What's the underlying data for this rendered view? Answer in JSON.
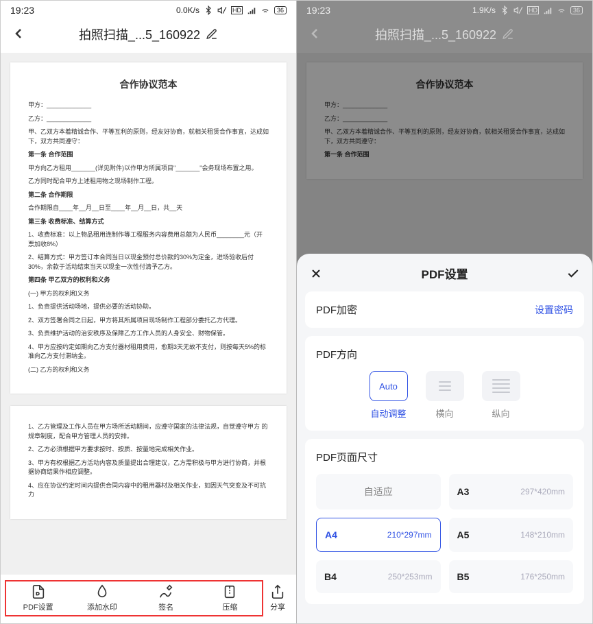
{
  "status": {
    "time": "19:23",
    "net_left": "0.0K/s",
    "net_right": "1.9K/s",
    "battery": "36"
  },
  "header": {
    "title": "拍照扫描_...5_160922"
  },
  "doc": {
    "title": "合作协议范本",
    "p1": "甲方：_____________",
    "p2": "乙方：_____________",
    "p3": "甲、乙双方本着精诚合作、平等互利的原则，经友好协商，就相关租赁合作事宜，达成如下，双方共同遵守：",
    "s1": "第一条  合作范围",
    "p4": "甲方向乙方租用_______(详见附件)以作甲方所属项目\"_______\"会务现场布置之用。",
    "p5": "乙方同时配合甲方上述租用物之现场制作工程。",
    "s2": "第二条  合作期限",
    "p6": "合作期限自____年__月__日至____年__月__日，共__天",
    "s3": "第三条  收费标准、结算方式",
    "p7": "1、收费标准：以上物品租用连制作等工程服务内容费用总额为人民币________元（开票加收8%）",
    "p8": "2、结算方式：甲方签订本合同当日以现金预付总价款的30%为定金，进场验收后付30%，余款于活动结束当天以现金一次性付清予乙方。",
    "s4": "第四条  甲乙双方的权利和义务",
    "p9": "(一) 甲方的权利和义务",
    "p10": "1、负责提供活动场地，提供必要的活动协助。",
    "p11": "2、双方签署合同之日起，甲方将其所属项目现场制作工程部分委托乙方代理。",
    "p12": "3、负责维护活动的治安秩序及保障乙方工作人员的人身安全、财物保管。",
    "p13": "4、甲方应按约定如期向乙方支付器材租用费用，愈期3天无故不支付，则按每天5%的标准向乙方支付滞纳金。",
    "p14": "(二) 乙方的权利和义务",
    "q1": "1、乙方管理及工作人员在甲方场所活动期间，应遵守国家的法律法规，自觉遵守甲方 的规章制度，配合甲方管理人员的安排。",
    "q2": "2、乙方必须根据甲方要求按时、按质、按量地完成相关作业。",
    "q3": "3、甲方有权根据乙方活动内容及质量提出合理建议，乙方需积极与甲方进行协商，并根据协商结果作相应调整。",
    "q4": "4、应在协议约定时间内提供合同内容中的租用器材及相关作业，如因天气突变及不可抗力"
  },
  "tools": {
    "pdf": "PDF设置",
    "water": "添加水印",
    "sign": "签名",
    "zip": "压缩",
    "share": "分享"
  },
  "sheet": {
    "title": "PDF设置",
    "encrypt": "PDF加密",
    "encrypt_action": "设置密码",
    "direction": "PDF方向",
    "dir_auto": "Auto",
    "dir_auto_lbl": "自动调整",
    "dir_h_lbl": "横向",
    "dir_v_lbl": "纵向",
    "size": "PDF页面尺寸",
    "fit": "自适应",
    "a3": "A3",
    "a3d": "297*420mm",
    "a4": "A4",
    "a4d": "210*297mm",
    "a5": "A5",
    "a5d": "148*210mm",
    "b4": "B4",
    "b4d": "250*253mm",
    "b5": "B5",
    "b5d": "176*250mm"
  }
}
